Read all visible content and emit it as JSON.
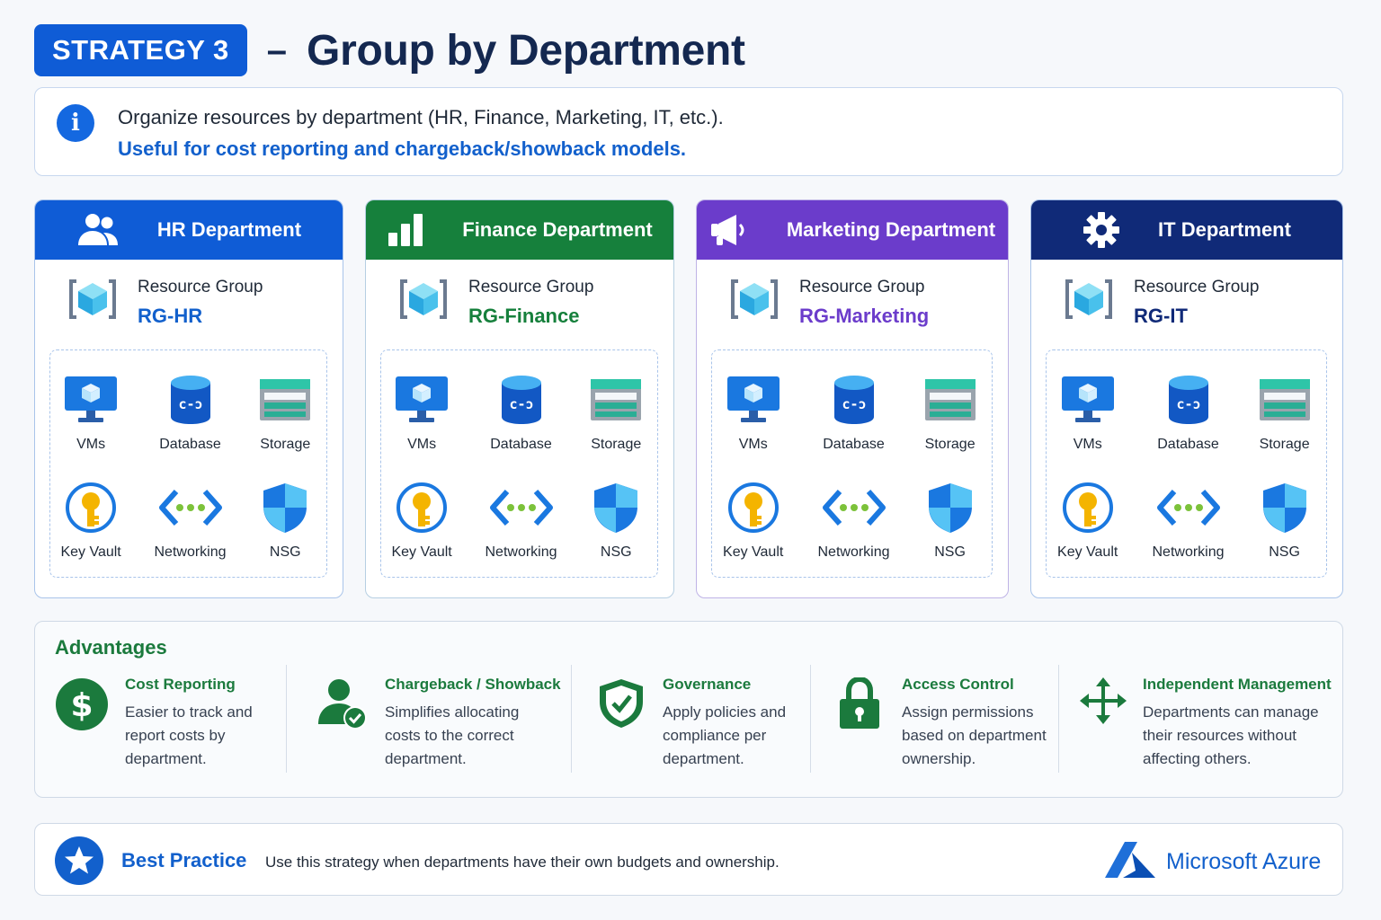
{
  "header": {
    "badge": "STRATEGY 3",
    "dash": "–",
    "title": "Group by Department"
  },
  "info": {
    "line1": "Organize resources by department (HR, Finance, Marketing, IT, etc.).",
    "line2": "Useful for cost reporting and chargeback/showback models."
  },
  "departments": [
    {
      "title": "HR Department",
      "rg_label": "Resource Group",
      "rg_name": "RG-HR",
      "color": "#0f5cd6",
      "rg_color": "#1260cc",
      "border": "#a9c4ea",
      "icon": "people-icon"
    },
    {
      "title": "Finance Department",
      "rg_label": "Resource Group",
      "rg_name": "RG-Finance",
      "color": "#16803c",
      "rg_color": "#16803c",
      "border": "#b6cfe2",
      "icon": "bar-chart-icon"
    },
    {
      "title": "Marketing Department",
      "rg_label": "Resource Group",
      "rg_name": "RG-Marketing",
      "color": "#6b3ccb",
      "rg_color": "#6b3ccb",
      "border": "#bfb3e6",
      "icon": "megaphone-icon"
    },
    {
      "title": "IT Department",
      "rg_label": "Resource Group",
      "rg_name": "RG-IT",
      "color": "#102a78",
      "rg_color": "#102a78",
      "border": "#a9c4ea",
      "icon": "gear-icon"
    }
  ],
  "resources": [
    "VMs",
    "Database",
    "Storage",
    "Key Vault",
    "Networking",
    "NSG"
  ],
  "advantages": {
    "title": "Advantages",
    "items": [
      {
        "title": "Cost Reporting",
        "desc": [
          "Easier to track and",
          "report costs by",
          "department."
        ],
        "icon": "dollar-icon"
      },
      {
        "title": "Chargeback / Showback",
        "desc": [
          "Simplifies allocating",
          "costs to the correct",
          "department."
        ],
        "icon": "user-check-icon"
      },
      {
        "title": "Governance",
        "desc": [
          "Apply policies and",
          "compliance per",
          "department."
        ],
        "icon": "shield-check-icon"
      },
      {
        "title": "Access Control",
        "desc": [
          "Assign permissions",
          "based on department",
          "ownership."
        ],
        "icon": "lock-icon"
      },
      {
        "title": "Independent Management",
        "desc": [
          "Departments can manage",
          "their resources without",
          "affecting others."
        ],
        "icon": "move-arrows-icon"
      }
    ]
  },
  "best_practice": {
    "title": "Best Practice",
    "text": "Use this strategy when departments have their own budgets and ownership.",
    "brand": "Microsoft Azure"
  },
  "colors": {
    "primary": "#0f5cd6",
    "green": "#16803c",
    "purple": "#6b3ccb",
    "navy": "#102a78",
    "advantage_green": "#1b7a3d"
  }
}
